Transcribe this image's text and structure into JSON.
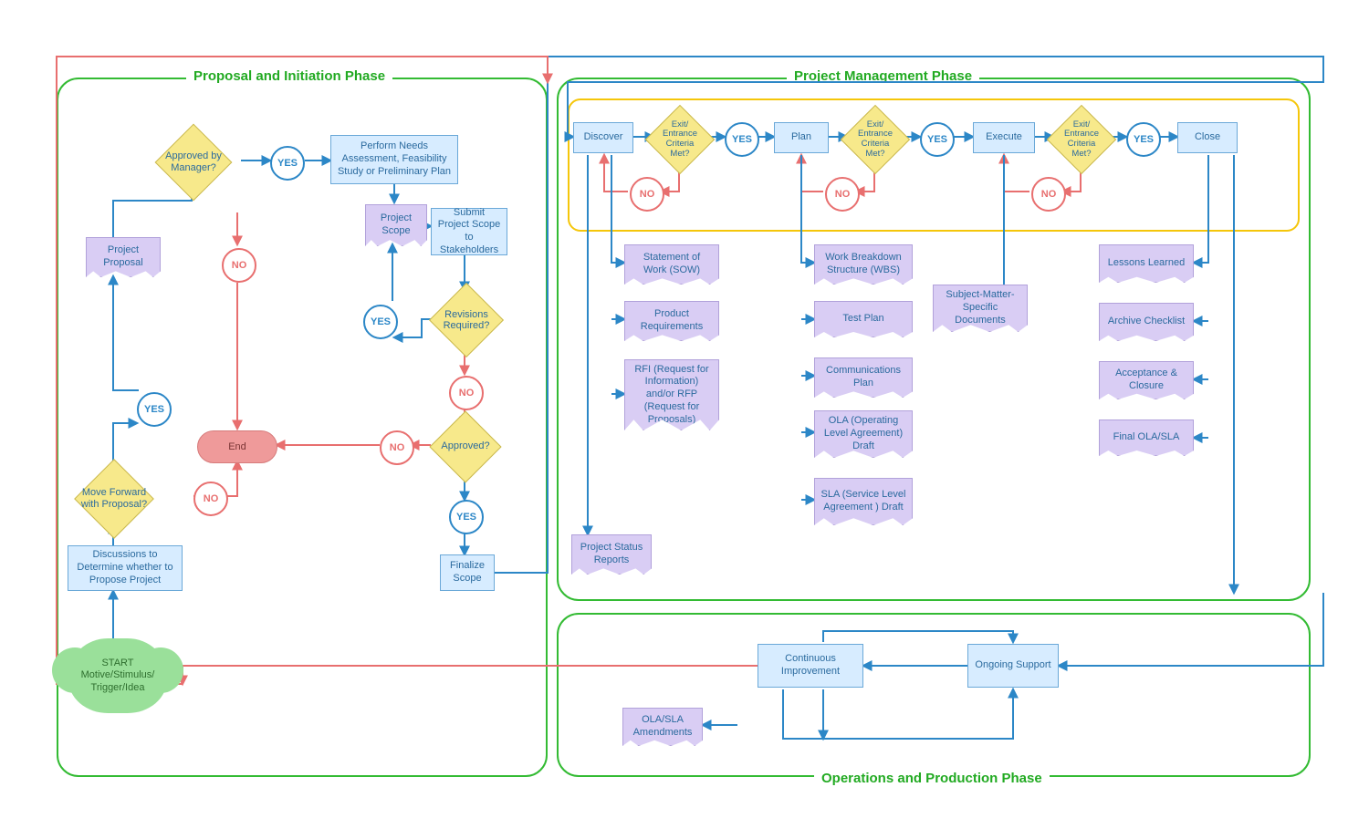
{
  "phases": {
    "proposal": "Proposal and Initiation Phase",
    "pm": "Project Management Phase",
    "ops": "Operations and Production Phase"
  },
  "labels": {
    "yes": "YES",
    "no": "NO",
    "end": "End"
  },
  "left": {
    "start": "START\nMotive/Stimulus/\nTrigger/Idea",
    "discussions": "Discussions\nto Determine whether\nto Propose Project",
    "moveForward": "Move Forward\nwith Proposal?",
    "projectProposal": "Project Proposal",
    "approvedByManager": "Approved by Manager?",
    "performNeeds": "Perform Needs Assessment, Feasibility Study or Preliminary Plan",
    "projectScope": "Project Scope",
    "submitScope": "Submit Project Scope to Stakeholders",
    "revisionsRequired": "Revisions Required?",
    "approved": "Approved?",
    "finalizeScope": "Finalize Scope"
  },
  "pm": {
    "discover": "Discover",
    "plan": "Plan",
    "execute": "Execute",
    "close": "Close",
    "exitEntrance": "Exit/\nEntrance\nCriteria\nMet?"
  },
  "docs": {
    "sow": "Statement of Work (SOW)",
    "productReq": "Product Requirements",
    "rfi": "RFI (Request for Information) and/or RFP (Request for Proposals)",
    "projStatus": "Project Status Reports",
    "wbs": "Work Breakdown Structure (WBS)",
    "testPlan": "Test Plan",
    "commPlan": "Communications Plan",
    "olaDraft": "OLA (Operating Level Agreement) Draft",
    "slaDraft": "SLA (Service Level Agreement ) Draft",
    "smDocs": "Subject-Matter-\nSpecific\nDocuments",
    "lessons": "Lessons Learned",
    "archive": "Archive Checklist",
    "acceptance": "Acceptance & Closure",
    "finalOla": "Final OLA/SLA",
    "olaAmend": "OLA/SLA\nAmendments"
  },
  "ops": {
    "continuous": "Continuous Improvement",
    "ongoing": "Ongoing Support"
  }
}
